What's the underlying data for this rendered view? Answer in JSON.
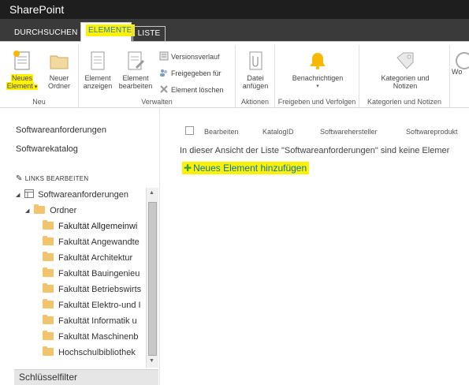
{
  "suite_bar": {
    "title": "SharePoint"
  },
  "ribbon_tabs": [
    {
      "label": "DURCHSUCHEN"
    },
    {
      "label": "ELEMENTE"
    },
    {
      "label": "LISTE"
    }
  ],
  "ribbon": {
    "groups": {
      "neu": {
        "label": "Neu",
        "new_item_line1": "Neues",
        "new_item_line2": "Element",
        "new_folder_line1": "Neuer",
        "new_folder_line2": "Ordner"
      },
      "verwalten": {
        "label": "Verwalten",
        "view_item_line1": "Element",
        "view_item_line2": "anzeigen",
        "edit_item_line1": "Element",
        "edit_item_line2": "bearbeiten",
        "version_history": "Versionsverlauf",
        "shared_with": "Freigegeben für",
        "delete_item": "Element löschen"
      },
      "aktionen": {
        "label": "Aktionen",
        "attach_file_line1": "Datei",
        "attach_file_line2": "anfügen"
      },
      "freigeben": {
        "label": "Freigeben und Verfolgen",
        "alert_me": "Benachrichtigen"
      },
      "kategorien": {
        "label": "Kategorien und Notizen",
        "tags_notes_line1": "Kategorien und",
        "tags_notes_line2": "Notizen"
      },
      "truncated": {
        "label": "Wo"
      }
    }
  },
  "left_nav": {
    "links": [
      {
        "label": "Softwareanforderungen"
      },
      {
        "label": "Softwarekatalog"
      }
    ],
    "edit_links": "LINKS BEARBEITEN",
    "tree": {
      "root": "Softwareanforderungen",
      "folder": "Ordner",
      "items": [
        "Fakultät Allgemeinwi",
        "Fakultät Angewandte",
        "Fakultät Architektur",
        "Fakultät Bauingenieu",
        "Fakultät Betriebswirts",
        "Fakultät Elektro-und I",
        "Fakultät Informatik u",
        "Fakultät Maschinenb",
        "Hochschulbibliothek"
      ]
    },
    "key_filter": "Schlüsselfilter"
  },
  "list": {
    "columns": [
      "Bearbeiten",
      "KatalogID",
      "Softwarehersteller",
      "Softwareprodukt"
    ],
    "empty_message": "In dieser Ansicht der Liste \"Softwareanforderungen\" sind keine Elemer",
    "add_new_item": "Neues Element hinzufügen"
  },
  "colors": {
    "suite_bar": "#1e1e1e",
    "tabs_bar": "#3a3a3a",
    "highlight": "#fff200",
    "link": "#0072c6",
    "folder": "#f2c46d"
  }
}
